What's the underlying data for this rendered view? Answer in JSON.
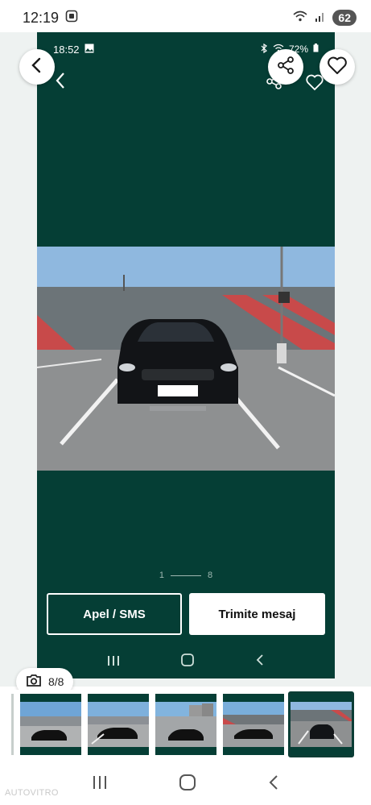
{
  "status_bar": {
    "time": "12:19",
    "battery": "62"
  },
  "inner_status_bar": {
    "time": "18:52",
    "battery": "72%"
  },
  "pager": {
    "current": "1",
    "total": "8"
  },
  "actions": {
    "call_label": "Apel / SMS",
    "message_label": "Trimite mesaj"
  },
  "photo_counter": {
    "text": "8/8"
  },
  "thumbnails": [
    {
      "index": 1,
      "selected": false
    },
    {
      "index": 2,
      "selected": false
    },
    {
      "index": 3,
      "selected": false
    },
    {
      "index": 4,
      "selected": false
    },
    {
      "index": 5,
      "selected": true
    }
  ],
  "watermark": "AUTOVITRO",
  "icons": {
    "back": "chevron-left-icon",
    "share": "share-icon",
    "favorite": "heart-icon",
    "camera": "camera-icon"
  },
  "colors": {
    "viewer_bg": "#053e35",
    "accent_dark_green": "#0b3d35",
    "frame_bg": "#eef2f1"
  }
}
